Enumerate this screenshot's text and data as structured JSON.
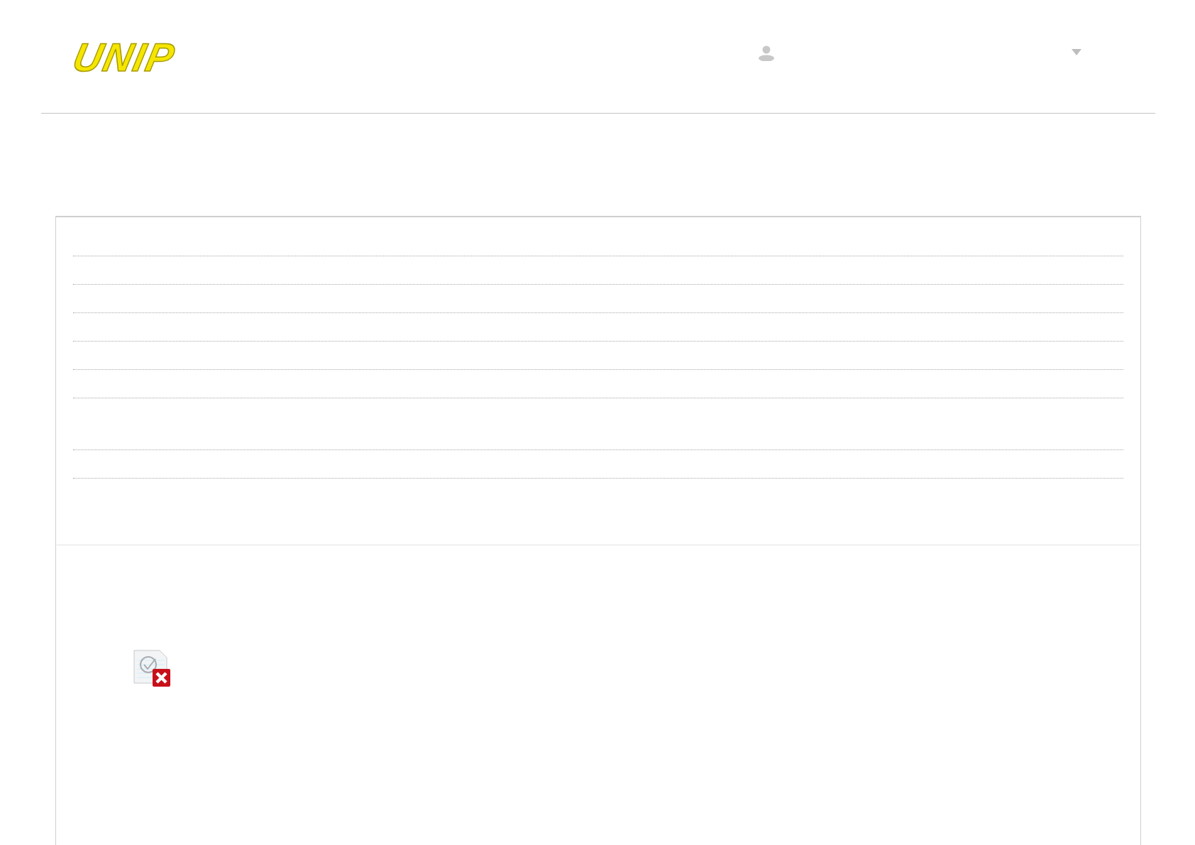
{
  "header": {
    "logo": "UNIP"
  }
}
